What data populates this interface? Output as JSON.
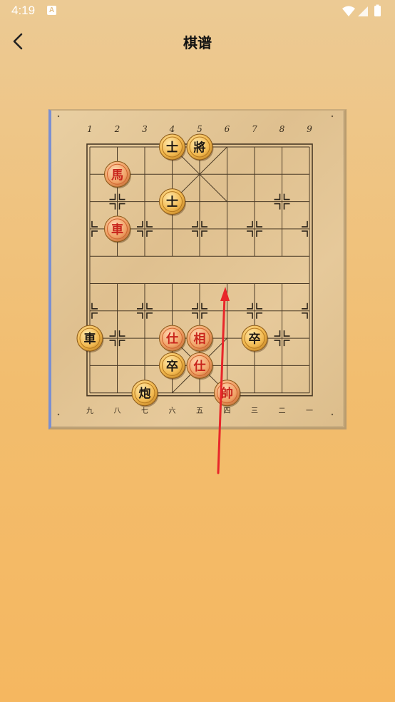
{
  "status_bar": {
    "time": "4:19",
    "notification_icon": "A"
  },
  "app_bar": {
    "title": "棋谱",
    "back_icon": "chevron-left-icon"
  },
  "board": {
    "top_labels": [
      "1",
      "2",
      "3",
      "4",
      "5",
      "6",
      "7",
      "8",
      "9"
    ],
    "bottom_labels": [
      "九",
      "八",
      "七",
      "六",
      "五",
      "四",
      "三",
      "二",
      "一"
    ],
    "pieces": [
      {
        "col": 3,
        "row": 0,
        "char": "士",
        "side": "black"
      },
      {
        "col": 4,
        "row": 0,
        "char": "將",
        "side": "black"
      },
      {
        "col": 1,
        "row": 1,
        "char": "馬",
        "side": "red"
      },
      {
        "col": 3,
        "row": 2,
        "char": "士",
        "side": "black"
      },
      {
        "col": 1,
        "row": 3,
        "char": "車",
        "side": "red"
      },
      {
        "col": 0,
        "row": 7,
        "char": "車",
        "side": "black"
      },
      {
        "col": 3,
        "row": 7,
        "char": "仕",
        "side": "red"
      },
      {
        "col": 4,
        "row": 7,
        "char": "相",
        "side": "red"
      },
      {
        "col": 6,
        "row": 7,
        "char": "卒",
        "side": "black"
      },
      {
        "col": 3,
        "row": 8,
        "char": "卒",
        "side": "black"
      },
      {
        "col": 4,
        "row": 8,
        "char": "仕",
        "side": "red"
      },
      {
        "col": 2,
        "row": 9,
        "char": "炮",
        "side": "black"
      },
      {
        "col": 5,
        "row": 9,
        "char": "帥",
        "side": "red"
      }
    ],
    "markers": [
      [
        1,
        2
      ],
      [
        7,
        2
      ],
      [
        0,
        3
      ],
      [
        2,
        3
      ],
      [
        4,
        3
      ],
      [
        6,
        3
      ],
      [
        8,
        3
      ],
      [
        0,
        6
      ],
      [
        2,
        6
      ],
      [
        4,
        6
      ],
      [
        6,
        6
      ],
      [
        8,
        6
      ],
      [
        1,
        7
      ],
      [
        7,
        7
      ]
    ],
    "annotation_arrow": {
      "color": "#e8262a"
    }
  }
}
